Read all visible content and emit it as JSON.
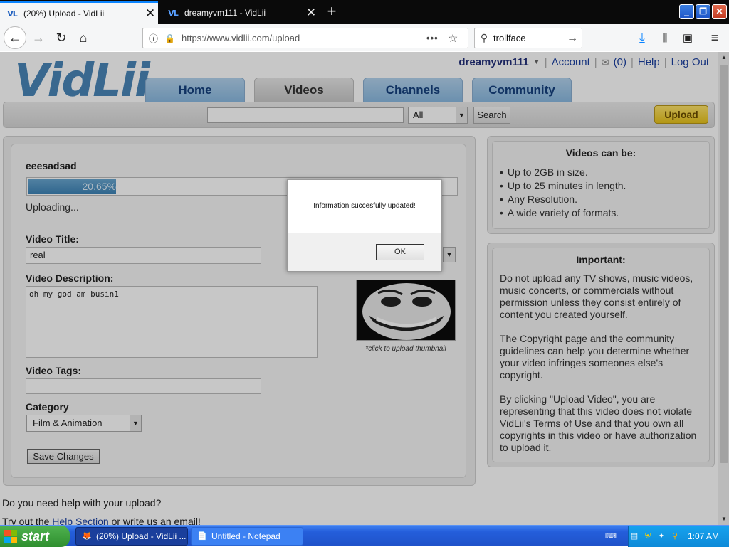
{
  "browser": {
    "tabs": [
      {
        "favicon": "VL",
        "title": "(20%) Upload - VidLii",
        "close": "✕"
      },
      {
        "favicon": "VL",
        "title": "dreamyvm111 - VidLii",
        "close": "✕"
      }
    ],
    "new_tab": "+",
    "url": "https://www.vidlii.com/upload",
    "url_dots": "•••",
    "search_query": "trollface"
  },
  "site": {
    "logo": "VidLii",
    "username": "dreamyvm111",
    "account_link": "Account",
    "inbox_count": "(0)",
    "help_link": "Help",
    "logout_link": "Log Out",
    "tabs": [
      "Home",
      "Videos",
      "Channels",
      "Community"
    ],
    "search_category": "All",
    "search_button": "Search",
    "upload_button": "Upload"
  },
  "upload": {
    "file_name": "eeesadsad",
    "progress_percent": 20.65,
    "progress_label": "20.65%",
    "status": "Uploading...",
    "title_label": "Video Title:",
    "title_value": "real",
    "description_label": "Video Description:",
    "description_value": "oh my god am busin1",
    "tags_label": "Video Tags:",
    "tags_value": "",
    "category_label": "Category",
    "category_value": "Film & Animation",
    "thumbnail_caption": "*click to upload thumbnail",
    "save_button": "Save Changes"
  },
  "sidebar": {
    "videos_title": "Videos can be:",
    "videos_items": [
      "Up to 2GB in size.",
      "Up to 25 minutes in length.",
      "Any Resolution.",
      "A wide variety of formats."
    ],
    "important_title": "Important:",
    "important_paragraphs": [
      "Do not upload any TV shows, music videos, music concerts, or commercials without permission unless they consist entirely of content you created yourself.",
      "The Copyright page and the community guidelines can help you determine whether your video infringes someones else's copyright.",
      "By clicking \"Upload Video\", you are representing that this video does not violate VidLii's Terms of Use and that you own all copyrights in this video or have authorization to upload it."
    ]
  },
  "help": {
    "question": "Do you need help with your upload?",
    "answer_prefix": "Try out the ",
    "help_link": "Help Section",
    "answer_suffix": " or write us an email!"
  },
  "dialog": {
    "message": "Information succesfully updated!",
    "ok_button": "OK"
  },
  "taskbar": {
    "start": "start",
    "tasks": [
      {
        "label": "(20%) Upload - VidLii ..."
      },
      {
        "label": "Untitled - Notepad"
      }
    ],
    "clock": "1:07 AM"
  },
  "colors": {
    "tab_blue": "#8ab9e0",
    "progress_blue": "#3d83b6",
    "upload_yellow": "#e7c21b",
    "taskbar_blue": "#245edb",
    "start_green": "#2f8f2f"
  }
}
